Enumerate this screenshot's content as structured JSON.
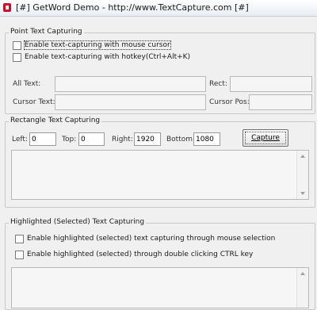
{
  "window": {
    "title": "[#] GetWord Demo - http://www.TextCapture.com [#]"
  },
  "point_capture": {
    "group_title": "Point Text Capturing",
    "enable_mouse_label": "Enable text-capturing with mouse cursor",
    "enable_hotkey_label": "Enable text-capturing with hotkey(Ctrl+Alt+K)",
    "all_text_label": "All Text:",
    "rect_label": "Rect:",
    "cursor_text_label": "Cursor Text:",
    "cursor_pos_label": "Cursor Pos:"
  },
  "rect_capture": {
    "group_title": "Rectangle Text Capturing",
    "left_label": "Left:",
    "left_value": "0",
    "top_label": "Top:",
    "top_value": "0",
    "right_label": "Right:",
    "right_value": "1920",
    "bottom_label": "Bottom:",
    "bottom_value": "1080",
    "capture_button": "Capture"
  },
  "highlight_capture": {
    "group_title": "Highlighted (Selected) Text Capturing",
    "mouse_selection_label": "Enable highlighted (selected) text capturing through mouse selection",
    "double_ctrl_label": "Enable highlighted (selected) through double clicking CTRL key"
  },
  "icons": {
    "app": "app-icon",
    "scroll_up": "scroll-up-arrow-icon",
    "scroll_down": "scroll-down-arrow-icon"
  },
  "colors": {
    "accent_red": "#c8102e",
    "window_bg": "#f0f0f0"
  }
}
